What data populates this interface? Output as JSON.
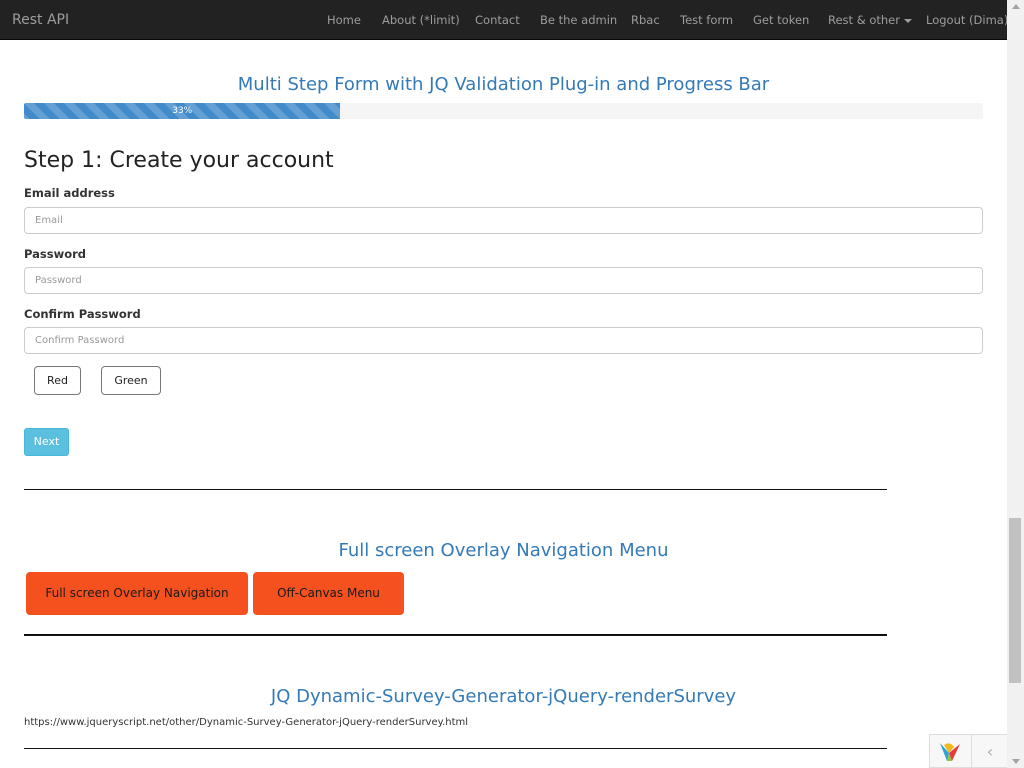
{
  "navbar": {
    "brand": "Rest API",
    "items": [
      {
        "label": "Home"
      },
      {
        "label": "About (*limit)"
      },
      {
        "label": "Contact"
      },
      {
        "label": "Be the admin"
      },
      {
        "label": "Rbac"
      },
      {
        "label": "Test form"
      },
      {
        "label": "Get token"
      },
      {
        "label": "Rest & other"
      },
      {
        "label": "Logout (Dima)"
      }
    ]
  },
  "form": {
    "title": "Multi Step Form with JQ Validation Plug-in and Progress Bar",
    "progress": {
      "value": 0.33,
      "label": "33%"
    },
    "step_title": "Step 1: Create your account",
    "fields": [
      {
        "label": "Email address",
        "placeholder": "Email"
      },
      {
        "label": "Password",
        "placeholder": "Password"
      },
      {
        "label": "Confirm Password",
        "placeholder": "Confirm Password"
      }
    ],
    "buttons": {
      "red": "Red",
      "green": "Green",
      "next": "Next"
    }
  },
  "overlay": {
    "title": "Full screen Overlay Navigation Menu",
    "buttons": [
      "Full screen Overlay Navigation",
      "Off-Canvas Menu"
    ],
    "button_color": "#f4511e"
  },
  "survey": {
    "title": "JQ Dynamic-Survey-Generator-jQuery-renderSurvey",
    "url": "https://www.jqueryscript.net/other/Dynamic-Survey-Generator-jQuery-renderSurvey.html"
  },
  "colors": {
    "navbar_bg": "#222222",
    "link_blue": "#337ab7",
    "progress_blue": "#428bca",
    "info_button": "#5bc0de"
  },
  "debug_toolbar": {
    "logo_icon": "yii-logo-icon",
    "toggle_icon": "chevron-left-icon"
  }
}
